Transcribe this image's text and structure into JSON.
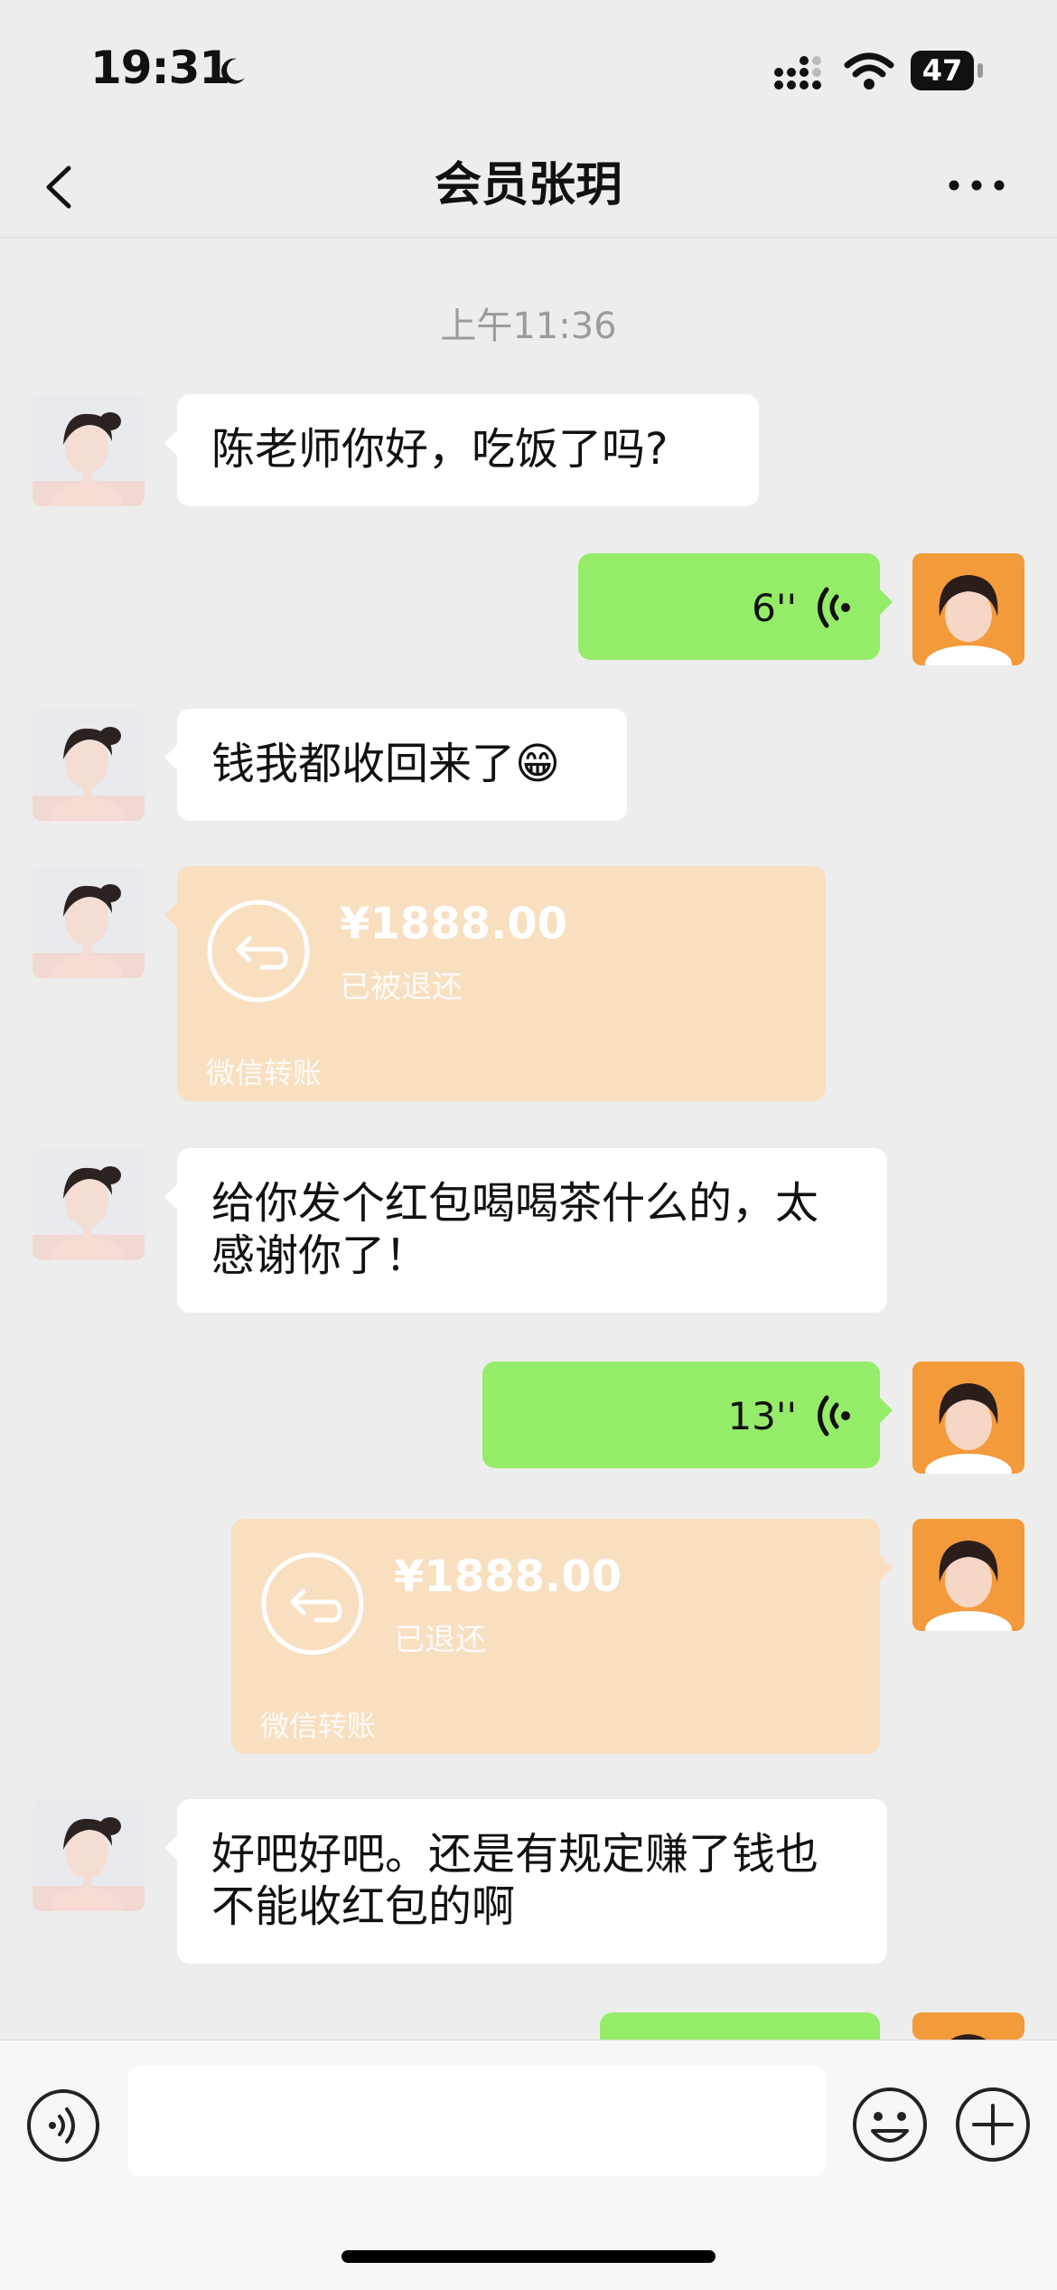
{
  "status_bar": {
    "time": "19:31",
    "battery": "47"
  },
  "nav": {
    "title": "会员张玥"
  },
  "timestamp": "上午11:36",
  "messages": [
    {
      "text": "陈老师你好，吃饭了吗?"
    },
    {
      "duration": "6''"
    },
    {
      "text": "钱我都收回来了😁"
    },
    {
      "amount": "¥1888.00",
      "status": "已被退还",
      "label": "微信转账"
    },
    {
      "text": "给你发个红包喝喝茶什么的，太感谢你了！"
    },
    {
      "duration": "13''"
    },
    {
      "amount": "¥1888.00",
      "status": "已退还",
      "label": "微信转账"
    },
    {
      "text": "好吧好吧。还是有规定赚了钱也不能收红包的啊"
    }
  ],
  "colors": {
    "outgoing_bubble": "#95ec69",
    "transfer_card": "#f8dfc0",
    "background": "#ededed"
  }
}
